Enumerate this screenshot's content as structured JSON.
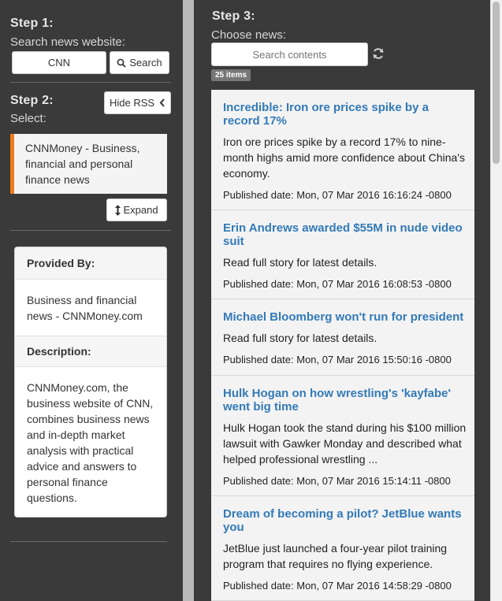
{
  "step1": {
    "title": "Step 1:",
    "subtitle": "Search news website:",
    "website_value": "CNN",
    "search_label": "Search"
  },
  "step2": {
    "title": "Step 2:",
    "subtitle": "Select:",
    "hide_rss_label": "Hide RSS",
    "feed_item": "CNNMoney - Business, financial and personal finance news",
    "expand_label": "Expand",
    "provided_by_heading": "Provided By:",
    "provided_by_text": "Business and financial news - CNNMoney.com",
    "description_heading": "Description:",
    "description_text": "CNNMoney.com, the business website of CNN, combines business news and in-depth market analysis with practical advice and answers to personal finance questions."
  },
  "step3": {
    "title": "Step 3:",
    "subtitle": "Choose news:",
    "search_placeholder": "Search contents",
    "items_badge": "25 items"
  },
  "news": [
    {
      "title": "Incredible: Iron ore prices spike by a record 17%",
      "desc": "Iron ore prices spike by a record 17% to nine-month highs amid more confidence about China's economy.",
      "date": "Published date: Mon, 07 Mar 2016 16:16:24 -0800"
    },
    {
      "title": "Erin Andrews awarded $55M in nude video suit",
      "desc": "Read full story for latest details.",
      "date": "Published date: Mon, 07 Mar 2016 16:08:53 -0800"
    },
    {
      "title": "Michael Bloomberg won't run for president",
      "desc": "Read full story for latest details.",
      "date": "Published date: Mon, 07 Mar 2016 15:50:16 -0800"
    },
    {
      "title": "Hulk Hogan on how wrestling's 'kayfabe' went big time",
      "desc": "Hulk Hogan took the stand during his $100 million lawsuit with Gawker Monday and described what helped professional wrestling ...",
      "date": "Published date: Mon, 07 Mar 2016 15:14:11 -0800"
    },
    {
      "title": "Dream of becoming a pilot? JetBlue wants you",
      "desc": "JetBlue just launched a four-year pilot training program that requires no flying experience.",
      "date": "Published date: Mon, 07 Mar 2016 14:58:29 -0800"
    }
  ],
  "colors": {
    "panel_bg": "#3a3a3a",
    "accent_orange": "#f07c1e",
    "link_blue": "#337ab7"
  }
}
